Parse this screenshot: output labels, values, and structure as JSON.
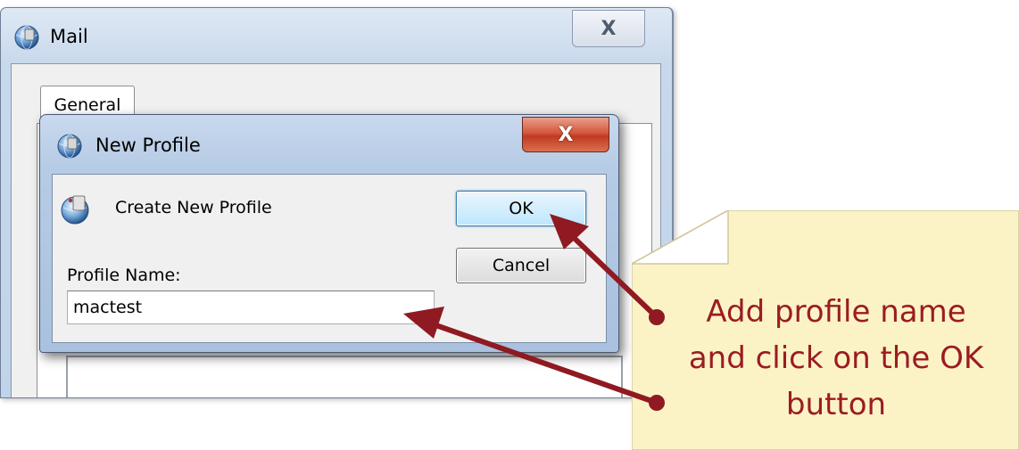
{
  "mail_window": {
    "title": "Mail",
    "close_glyph": "X",
    "tabs": [
      {
        "label": "General"
      }
    ]
  },
  "new_profile_dialog": {
    "title": "New Profile",
    "close_glyph": "X",
    "heading": "Create New Profile",
    "ok_label": "OK",
    "cancel_label": "Cancel",
    "profile_name_label": "Profile Name:",
    "profile_name_value": "mactest"
  },
  "callout": {
    "text_lines": [
      "Add profile name",
      "and click on the OK",
      "button"
    ]
  },
  "colors": {
    "callout_fill": "#fbf3c6",
    "callout_border": "#d2c79c",
    "callout_text": "#9b1c22",
    "arrow": "#8f1a22"
  },
  "icons": {
    "mail_window": "mail-globe-icon",
    "new_profile_window": "mail-globe-icon",
    "profile": "profile-globe-icon",
    "mail_close": "close-icon",
    "dialog_close": "close-icon"
  }
}
